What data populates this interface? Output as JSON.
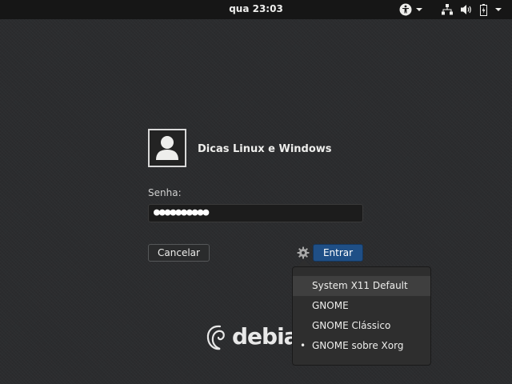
{
  "topbar": {
    "clock": "qua 23:03",
    "icons": [
      "accessibility-icon",
      "chevron-down-icon",
      "network-icon",
      "volume-icon",
      "battery-icon",
      "chevron-down-icon"
    ]
  },
  "login": {
    "username": "Dicas Linux e Windows",
    "password_label": "Senha:",
    "password_value": "●●●●●●●●●●",
    "cancel_label": "Cancelar",
    "login_label": "Entrar"
  },
  "session_menu": {
    "items": [
      {
        "label": "System X11 Default",
        "selected": false
      },
      {
        "label": "GNOME",
        "selected": false
      },
      {
        "label": "GNOME Clássico",
        "selected": false
      },
      {
        "label": "GNOME sobre Xorg",
        "selected": true
      }
    ],
    "selected_marker": "•"
  },
  "branding": {
    "logo_text": "debian"
  },
  "colors": {
    "accent": "#1f4f86",
    "background": "#2b2c2e",
    "topbar": "#161616"
  }
}
